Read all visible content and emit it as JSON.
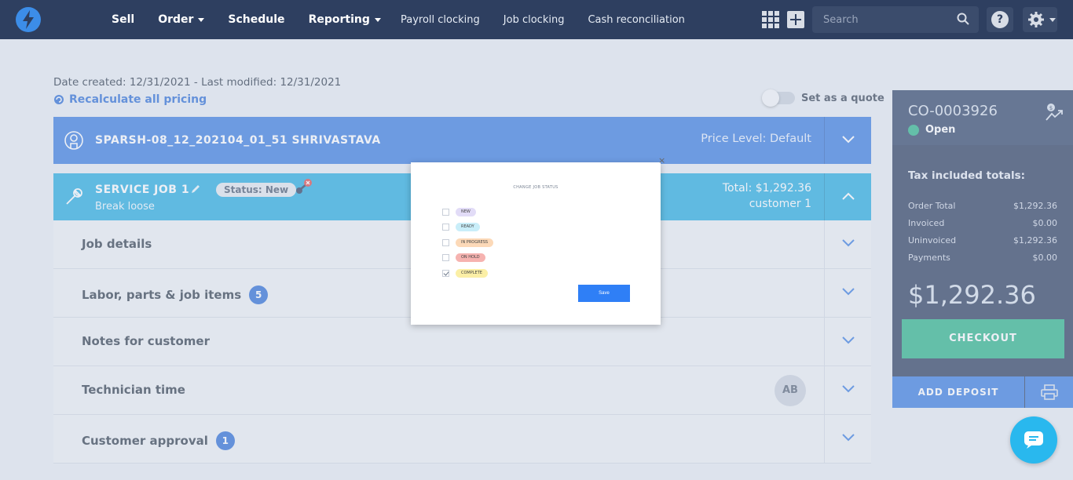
{
  "nav": {
    "main": [
      {
        "label": "Sell",
        "dropdown": false
      },
      {
        "label": "Order",
        "dropdown": true
      },
      {
        "label": "Schedule",
        "dropdown": false
      },
      {
        "label": "Reporting",
        "dropdown": true
      }
    ],
    "sub": [
      "Payroll clocking",
      "Job clocking",
      "Cash reconciliation"
    ],
    "search_placeholder": "Search",
    "help_glyph": "?"
  },
  "page": {
    "dates": "Date created: 12/31/2021 - Last modified: 12/31/2021",
    "recalculate": "Recalculate all pricing",
    "quote_toggle_label": "Set as a quote",
    "quote_toggle_on": false
  },
  "customer": {
    "name": "SPARSH-08_12_202104_01_51 SHRIVASTAVA",
    "price_level": "Price Level: Default"
  },
  "job": {
    "title": "SERVICE JOB 1",
    "subtitle": "Break loose",
    "status_badge": "Status: New",
    "total": "Total: $1,292.36",
    "customer": "customer 1"
  },
  "sections": [
    {
      "label": "Job details",
      "count": ""
    },
    {
      "label": "Labor, parts & job items",
      "count": "5"
    },
    {
      "label": "Notes for customer",
      "count": ""
    },
    {
      "label": "Technician time",
      "count": "",
      "avatar": "AB"
    },
    {
      "label": "Customer approval",
      "count": "1"
    }
  ],
  "panel": {
    "order_number": "CO-0003926",
    "status": "Open",
    "tax_title": "Tax included totals:",
    "rows": [
      {
        "label": "Order Total",
        "value": "$1,292.36"
      },
      {
        "label": "Invoiced",
        "value": "$0.00"
      },
      {
        "label": "Uninvoiced",
        "value": "$1,292.36"
      },
      {
        "label": "Payments",
        "value": "$0.00"
      }
    ],
    "big_total": "$1,292.36",
    "checkout": "CHECKOUT",
    "add_deposit": "ADD DEPOSIT"
  },
  "modal": {
    "title": "CHANGE JOB STATUS",
    "close": "×",
    "options": [
      {
        "label": "NEW",
        "checked": false,
        "color": "#e2dcf7"
      },
      {
        "label": "READY",
        "checked": false,
        "color": "#c9eef9"
      },
      {
        "label": "IN PROGRESS",
        "checked": false,
        "color": "#fcd9b8"
      },
      {
        "label": "ON HOLD",
        "checked": false,
        "color": "#f6b3b0"
      },
      {
        "label": "COMPLETE",
        "checked": true,
        "color": "#fbefa6"
      }
    ],
    "save": "Save"
  },
  "colors": {
    "topbar": "#2e3f60",
    "accent_blue": "#3c7fe0",
    "job_cyan": "#29aee0",
    "checkout_green": "#2fb58a"
  }
}
